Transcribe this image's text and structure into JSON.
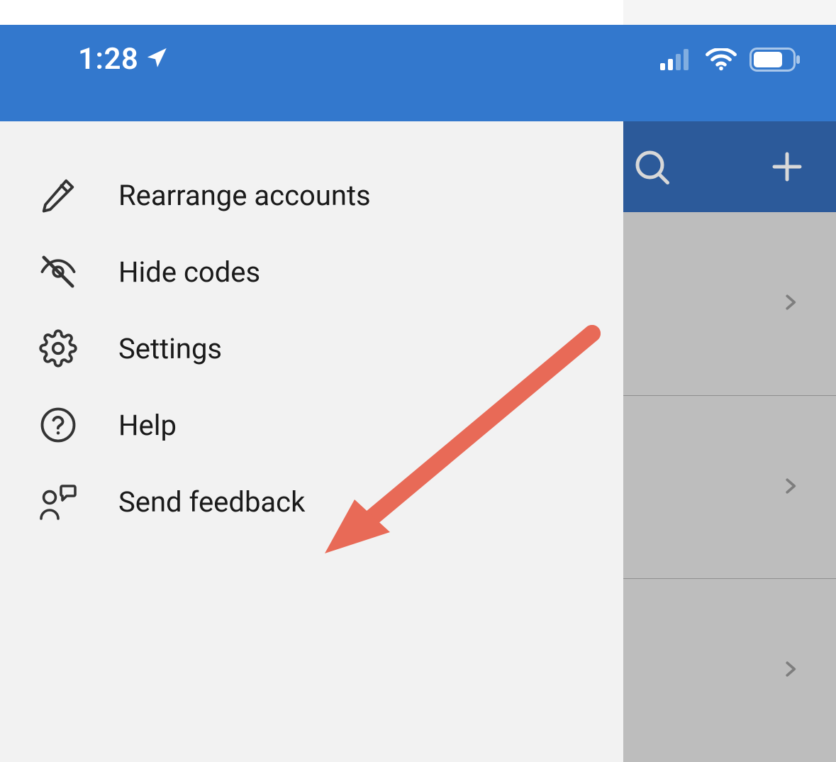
{
  "statusbar": {
    "time": "1:28",
    "icons": {
      "location": "location-arrow-icon",
      "signal": "cellular-signal-icon",
      "wifi": "wifi-icon",
      "battery": "battery-icon"
    }
  },
  "menu": {
    "items": [
      {
        "label": "Rearrange accounts",
        "icon": "pencil-icon"
      },
      {
        "label": "Hide codes",
        "icon": "eye-off-icon"
      },
      {
        "label": "Settings",
        "icon": "gear-icon"
      },
      {
        "label": "Help",
        "icon": "help-circle-icon"
      },
      {
        "label": "Send feedback",
        "icon": "feedback-icon"
      }
    ]
  },
  "right_panel": {
    "header": {
      "search_icon": "search-icon",
      "add_icon": "plus-icon"
    },
    "rows_visible": 3
  },
  "colors": {
    "brand_blue": "#3378cd",
    "header_blue": "#2c5a9a",
    "annotation_red": "#e86a57"
  }
}
